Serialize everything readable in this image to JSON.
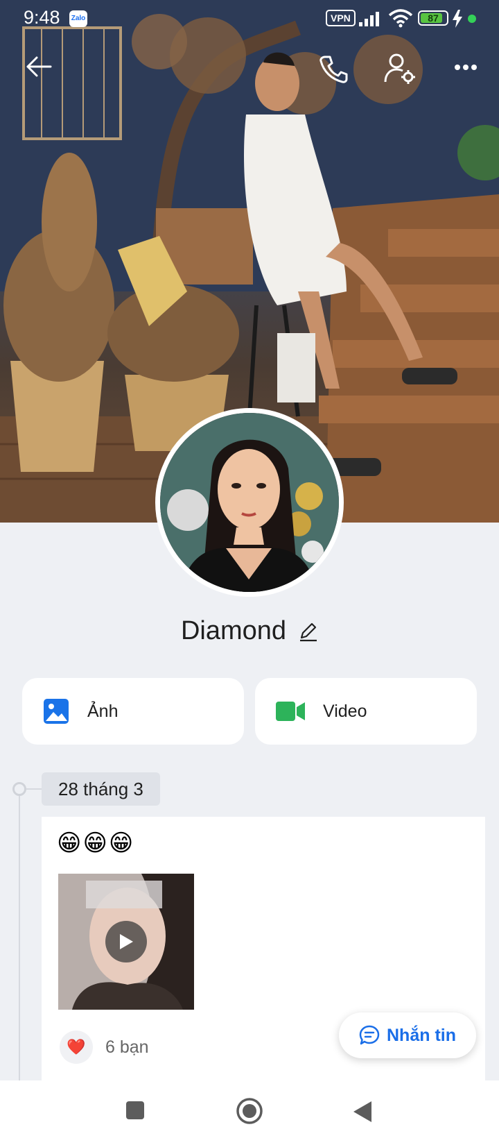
{
  "status_bar": {
    "time": "9:48",
    "app_badge": "Zalo",
    "vpn_label": "VPN",
    "battery_level": 87,
    "battery_text": "87"
  },
  "header": {
    "back_icon": "arrow-left-icon",
    "call_icon": "phone-icon",
    "profile_settings_icon": "user-gear-icon",
    "more_icon": "more-horizontal-icon"
  },
  "profile": {
    "name": "Diamond",
    "edit_icon": "pencil-icon"
  },
  "media_buttons": [
    {
      "label": "Ảnh",
      "icon": "image-icon",
      "color": "#1a73e8"
    },
    {
      "label": "Video",
      "icon": "video-camera-icon",
      "color": "#2db35a"
    }
  ],
  "timeline": {
    "date": "28 tháng 3",
    "post": {
      "text": "😁😁😁",
      "has_video": true,
      "reaction_icon": "❤️",
      "reaction_count": "6 bạn"
    }
  },
  "message_button": {
    "label": "Nhắn tin",
    "icon": "chat-bubble-icon"
  },
  "nav_bar": {
    "buttons": [
      "recent-apps-icon",
      "home-icon",
      "back-triangle-icon"
    ]
  },
  "colors": {
    "accent": "#1a6ee8",
    "background": "#eef0f4"
  }
}
